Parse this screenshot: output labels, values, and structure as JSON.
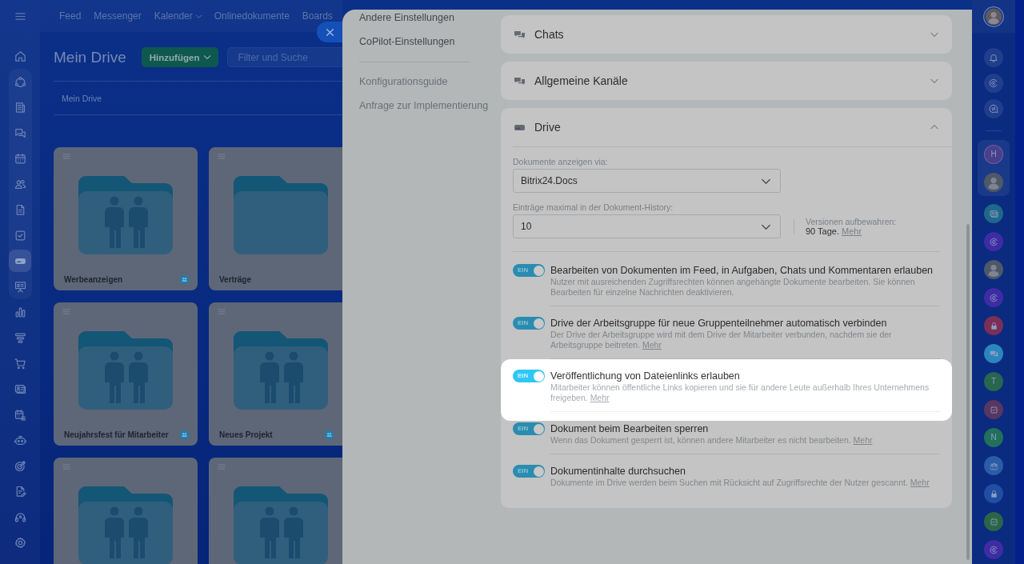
{
  "top_nav": [
    {
      "label": "Feed",
      "dropdown": false
    },
    {
      "label": "Messenger",
      "dropdown": false
    },
    {
      "label": "Kalender",
      "dropdown": true
    },
    {
      "label": "Onlinedokumente",
      "dropdown": false
    },
    {
      "label": "Boards",
      "dropdown": false
    }
  ],
  "left_sidebar": {
    "top_items": [
      {
        "kind": "home",
        "selected": false
      }
    ],
    "pinned_items": [
      {
        "kind": "nodes",
        "selected": false
      },
      {
        "kind": "news",
        "selected": false
      },
      {
        "kind": "chat",
        "selected": false
      },
      {
        "kind": "calendar",
        "selected": false
      },
      {
        "kind": "people",
        "selected": false
      },
      {
        "kind": "document",
        "selected": false
      },
      {
        "kind": "task",
        "selected": false
      },
      {
        "kind": "drive",
        "selected": true
      },
      {
        "kind": "board",
        "selected": false
      }
    ],
    "items": [
      {
        "kind": "chart",
        "selected": false
      },
      {
        "kind": "funnel",
        "selected": false
      },
      {
        "kind": "cart",
        "selected": false
      },
      {
        "kind": "contact",
        "selected": false
      },
      {
        "kind": "schedule",
        "selected": false
      },
      {
        "kind": "robot",
        "selected": false
      },
      {
        "kind": "target",
        "selected": false
      },
      {
        "kind": "signature",
        "selected": false
      },
      {
        "kind": "headset",
        "selected": false
      },
      {
        "kind": "settings",
        "selected": false
      }
    ]
  },
  "drive_page": {
    "title": "Mein Drive",
    "add_button": "Hinzufügen",
    "search": {
      "placeholder": "Filter und Suche"
    },
    "breadcrumb": "Mein Drive",
    "folders": [
      {
        "name": "Werbeanzeigen",
        "kind": "group",
        "shared": true
      },
      {
        "name": "Verträge",
        "kind": "plain",
        "shared": false
      },
      {
        "name": "Neujahrsfest für Mitarbeiter",
        "kind": "group",
        "shared": true
      },
      {
        "name": "Neues Projekt",
        "kind": "group",
        "shared": true
      },
      {
        "kind": "group"
      },
      {
        "kind": "group"
      }
    ]
  },
  "settings_panel": {
    "nav_items": [
      {
        "label": "Andere Einstellungen"
      },
      {
        "label": "CoPilot-Einstellungen"
      }
    ],
    "help_links": [
      {
        "label": "Konfigurationsguide"
      },
      {
        "label": "Anfrage zur Implementierung"
      }
    ],
    "sections": [
      {
        "title": "Chats",
        "kind": "chats",
        "expanded": false
      },
      {
        "title": "Allgemeine Kanäle",
        "kind": "channels",
        "expanded": false
      },
      {
        "title": "Drive",
        "kind": "drive",
        "expanded": true,
        "selects": [
          {
            "label": "Dokumente anzeigen via:",
            "value": "Bitrix24.Docs"
          },
          {
            "label": "Einträge maximal in der Dokument-History:",
            "value": "10",
            "note": {
              "label": "Versionen aufbewahren:",
              "value": "90 Tage.",
              "link": "Mehr"
            }
          }
        ],
        "toggles": [
          {
            "title": "Bearbeiten von Dokumenten im Feed, in Aufgaben, Chats und Kommentaren erlauben",
            "description": "Nutzer mit ausreichenden Zugriffsrechten können angehängte Dokumente bearbeiten. Sie können Bearbeiten für einzelne Nachrichten deaktivieren.",
            "on": true,
            "state_label": "EIN",
            "highlighted": false
          },
          {
            "title": "Drive der Arbeitsgruppe für neue Gruppenteilnehmer automatisch verbinden",
            "description": "Der Drive der Arbeitsgruppe wird mit dem Drive der Mitarbeiter verbunden, nachdem sie der Arbeitsgruppe beitreten.",
            "link": "Mehr",
            "on": true,
            "state_label": "EIN",
            "highlighted": false
          },
          {
            "title": "Veröffentlichung von Dateienlinks erlauben",
            "description": "Mitarbeiter können öffentliche Links kopieren und sie für andere Leute außerhalb Ihres Unternehmens freigeben.",
            "link": "Mehr",
            "on": true,
            "state_label": "EIN",
            "highlighted": true
          },
          {
            "title": "Dokument beim Bearbeiten sperren",
            "description": "Wenn das Dokument gesperrt ist, können andere Mitarbeiter es nicht bearbeiten.",
            "link": "Mehr",
            "on": true,
            "state_label": "EIN",
            "highlighted": false
          },
          {
            "title": "Dokumentinhalte durchsuchen",
            "description": "Dokumente im Drive werden beim Suchen mit Rücksicht auf Zugriffsrechte der Nutzer gescannt.",
            "link": "Mehr",
            "on": true,
            "state_label": "EIN",
            "highlighted": false
          }
        ]
      }
    ]
  },
  "right_sidebar": {
    "tools": [
      {
        "kind": "bell"
      },
      {
        "kind": "swirl"
      },
      {
        "kind": "chat"
      }
    ],
    "pinned_chats": [
      {
        "kind": "letter",
        "letter": "H",
        "color": "#4a3f8c"
      },
      {
        "kind": "photo"
      }
    ],
    "chats": [
      {
        "kind": "contact",
        "color": "#1f6889"
      },
      {
        "kind": "swirl",
        "color": "#3f2ca4"
      },
      {
        "kind": "photo"
      },
      {
        "kind": "swirl",
        "color": "#3f2ca4"
      },
      {
        "kind": "lock",
        "color": "#7b2f57"
      },
      {
        "kind": "bubble",
        "color": "#2a86bd"
      },
      {
        "kind": "letter",
        "letter": "T",
        "color": "#27664f"
      },
      {
        "kind": "check",
        "color": "#58365f"
      },
      {
        "kind": "letter",
        "letter": "N",
        "color": "#22705a"
      },
      {
        "kind": "people",
        "color": "#2b5ca7"
      },
      {
        "kind": "lock",
        "color": "#1f4ea3"
      },
      {
        "kind": "check",
        "color": "#2b6548"
      },
      {
        "kind": "swirl",
        "color": "#3f2ca4"
      }
    ]
  }
}
